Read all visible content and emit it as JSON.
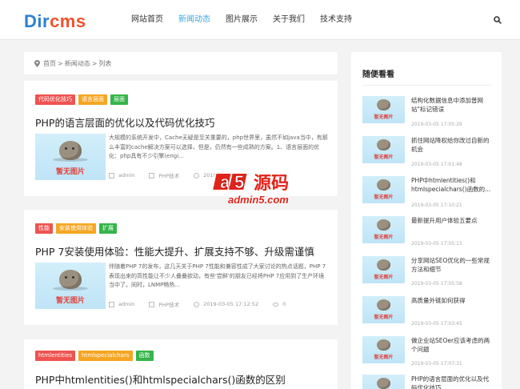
{
  "header": {
    "logo_main": "Dir",
    "logo_accent": "cms",
    "nav": [
      {
        "label": "网站首页",
        "active": false
      },
      {
        "label": "新闻动态",
        "active": true
      },
      {
        "label": "图片展示",
        "active": false
      },
      {
        "label": "关于我们",
        "active": false
      },
      {
        "label": "技术支持",
        "active": false
      }
    ],
    "search_icon": "search-icon"
  },
  "breadcrumb": {
    "icon": "location-pin-icon",
    "items": [
      "首页",
      "新闻动态",
      "列表"
    ],
    "separator": ">"
  },
  "placeholder_image_label": "暂无图片",
  "articles": [
    {
      "tags": [
        {
          "text": "代码优化技巧",
          "color": "#ef5350"
        },
        {
          "text": "语言层面",
          "color": "#f5a623"
        },
        {
          "text": "层面",
          "color": "#36b54a"
        }
      ],
      "title": "PHP的语言层面的优化以及代码优化技巧",
      "excerpt": "大规模的系统开发中，Cache无疑是至关重要的，php世界里，虽然不如java当中，有那么丰富的cache解决方案可以选择，但是，仍然有一些成熟的方案。1、语言层面的优化：php具有不少引擎(engi...",
      "author": "admin",
      "category": "PHP技术",
      "date": "2019-",
      "views": ""
    },
    {
      "tags": [
        {
          "text": "性能",
          "color": "#ef5350"
        },
        {
          "text": "安装使用体验",
          "color": "#f5a623"
        },
        {
          "text": "扩展",
          "color": "#36b54a"
        }
      ],
      "title": "PHP 7安装使用体验：性能大提升、扩展支持不够、升级需谨慎",
      "excerpt": "伴随着PHP 7的发布，这几天关于PHP 7性能和兼容性成了大家讨论的热点话题，PHP 7表现出来的高性能让不少人叠叠欲动，有些'尝鲜'的朋友已经将PHP 7应用到了生产环境当中了。同时，LNMP畅热...",
      "author": "admin",
      "category": "PHP技术",
      "date": "2019-03-05 17:12:52",
      "views": "0"
    },
    {
      "tags": [
        {
          "text": "htmlentities",
          "color": "#ef5350"
        },
        {
          "text": "htmlspecialchars",
          "color": "#f5a623"
        },
        {
          "text": "函数",
          "color": "#36b54a"
        }
      ],
      "title": "PHP中htmlentities()和htmlspecialchars()函数的区别"
    }
  ],
  "sidebar": {
    "title": "随便看看",
    "items": [
      {
        "title": "结构化数据信息中添加普网站\"标记错误",
        "date": "2019-03-05 17:05:29"
      },
      {
        "title": "抓住网站降权给你改过自新的机会",
        "date": "2019-03-05 17:01:48"
      },
      {
        "title": "PHP中htmlentities()和htmlspecialchars()函数的...",
        "date": "2019-03-05 17:10:21"
      },
      {
        "title": "最新提升用户体验五要点",
        "date": "2019-03-05 17:05:13"
      },
      {
        "title": "分享网站SEO优化的一些常规方法和细节",
        "date": "2019-03-05 17:05:58"
      },
      {
        "title": "高质量外链如何获得",
        "date": "2019-03-05 17:03:45"
      },
      {
        "title": "做企业站SEOer应该考虑的两个问题",
        "date": "2019-03-05 17:07:31"
      },
      {
        "title": "PHP的语言层面的优化以及代码优化技巧",
        "date": ""
      }
    ]
  },
  "watermark": {
    "brand_a": "a",
    "brand_5": "5",
    "brand_text": "源码",
    "domain": "admin5.com"
  }
}
